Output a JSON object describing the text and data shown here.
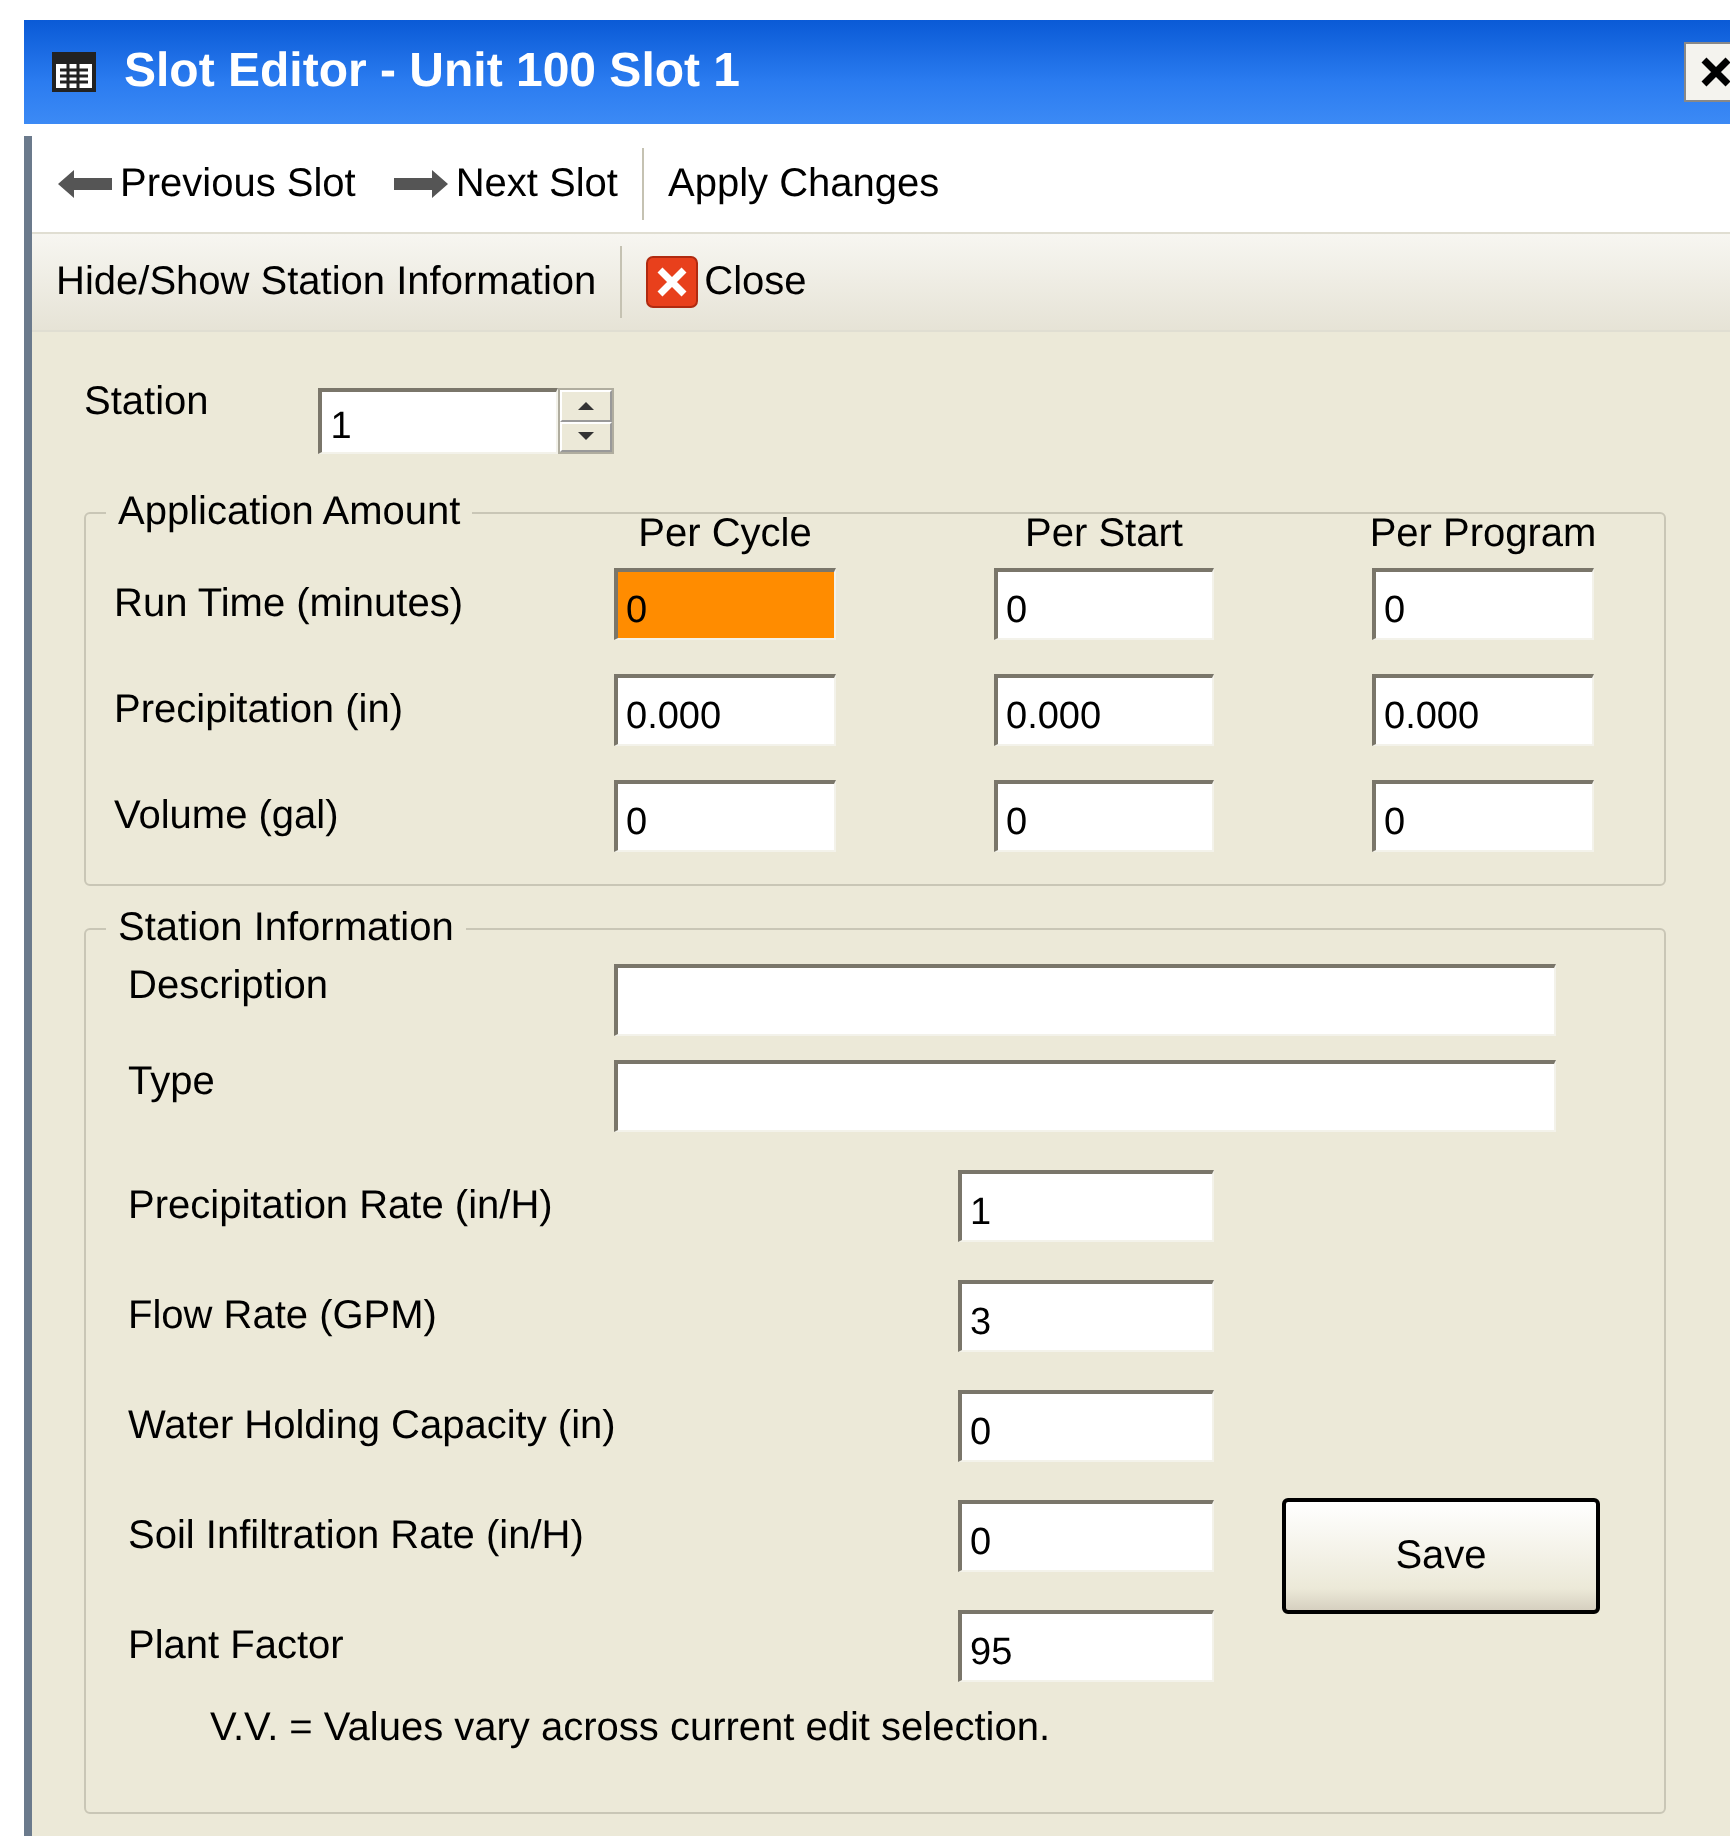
{
  "window": {
    "title": "Slot Editor - Unit 100 Slot 1"
  },
  "toolbars": [
    {
      "groups": [
        [
          {
            "kind": "left-arrow",
            "label": "Previous Slot"
          },
          {
            "kind": "right-arrow",
            "label": "Next Slot"
          }
        ],
        [
          {
            "kind": "none",
            "label": "Apply Changes"
          }
        ]
      ]
    },
    {
      "groups": [
        [
          {
            "kind": "none",
            "label": "Hide/Show Station Information"
          }
        ],
        [
          {
            "kind": "close",
            "label": "Close"
          }
        ]
      ]
    }
  ],
  "station": {
    "label": "Station",
    "value": "1"
  },
  "application_amount": {
    "title": "Application Amount",
    "columns": [
      "Per Cycle",
      "Per Start",
      "Per Program"
    ],
    "rows": [
      {
        "label": "Run Time (minutes)",
        "cells": [
          {
            "value": "0",
            "highlighted": true
          },
          {
            "value": "0",
            "highlighted": false
          },
          {
            "value": "0",
            "highlighted": false
          }
        ]
      },
      {
        "label": "Precipitation (in)",
        "cells": [
          {
            "value": "0.000",
            "highlighted": false
          },
          {
            "value": "0.000",
            "highlighted": false
          },
          {
            "value": "0.000",
            "highlighted": false
          }
        ]
      },
      {
        "label": "Volume (gal)",
        "cells": [
          {
            "value": "0",
            "highlighted": false
          },
          {
            "value": "0",
            "highlighted": false
          },
          {
            "value": "0",
            "highlighted": false
          }
        ]
      }
    ]
  },
  "station_information": {
    "title": "Station Information",
    "text_fields": [
      {
        "label": "Description"
      },
      {
        "label": "Type"
      }
    ],
    "number_fields": [
      {
        "label": "Precipitation Rate (in/H)",
        "value": "1"
      },
      {
        "label": "Flow Rate (GPM)",
        "value": "3"
      },
      {
        "label": "Water Holding Capacity (in)",
        "value": "0"
      },
      {
        "label": "Soil Infiltration Rate (in/H)",
        "value": "0"
      },
      {
        "label": "Plant Factor",
        "value": "95"
      }
    ],
    "save_button": "Save",
    "note": "V.V. = Values vary across current edit selection."
  }
}
